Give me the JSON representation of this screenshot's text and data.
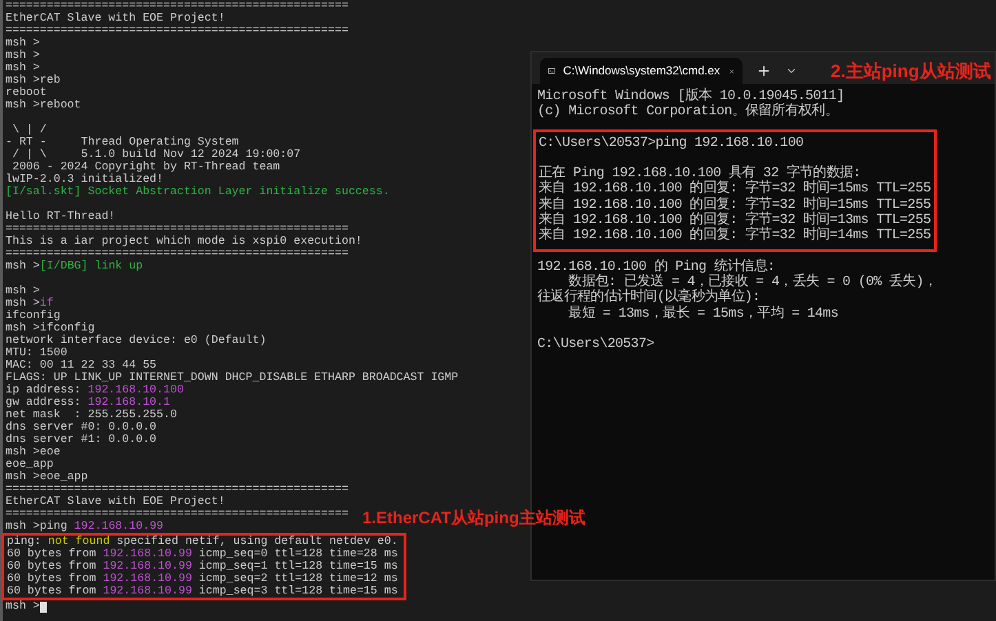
{
  "serial_terminal": {
    "cursor_visible": true,
    "blocks": [
      {
        "boxed": false,
        "lines": [
          {
            "kind": "text",
            "segments": [
              {
                "text": "==================================================",
                "color": "#cccccc"
              }
            ]
          },
          {
            "kind": "text",
            "segments": [
              {
                "text": "EtherCAT Slave with EOE Project!",
                "color": "#cccccc"
              }
            ]
          },
          {
            "kind": "text",
            "segments": [
              {
                "text": "==================================================",
                "color": "#cccccc"
              }
            ]
          },
          {
            "kind": "text",
            "segments": [
              {
                "text": "msh >",
                "color": "#cccccc"
              }
            ]
          },
          {
            "kind": "text",
            "segments": [
              {
                "text": "msh >",
                "color": "#cccccc"
              }
            ]
          },
          {
            "kind": "text",
            "segments": [
              {
                "text": "msh >",
                "color": "#cccccc"
              }
            ]
          },
          {
            "kind": "text",
            "segments": [
              {
                "text": "msh >reb",
                "color": "#cccccc"
              }
            ]
          },
          {
            "kind": "text",
            "segments": [
              {
                "text": "reboot",
                "color": "#cccccc"
              }
            ]
          },
          {
            "kind": "text",
            "segments": [
              {
                "text": "msh >reboot",
                "color": "#cccccc"
              }
            ]
          },
          {
            "kind": "blank"
          },
          {
            "kind": "text",
            "segments": [
              {
                "text": " \\ | /",
                "color": "#cccccc"
              }
            ]
          },
          {
            "kind": "text",
            "segments": [
              {
                "text": "- RT -     Thread Operating System",
                "color": "#cccccc"
              }
            ]
          },
          {
            "kind": "text",
            "segments": [
              {
                "text": " / | \\     5.1.0 build Nov 12 2024 19:00:07",
                "color": "#cccccc"
              }
            ]
          },
          {
            "kind": "text",
            "segments": [
              {
                "text": " 2006 - 2024 Copyright by RT-Thread team",
                "color": "#cccccc"
              }
            ]
          },
          {
            "kind": "text",
            "segments": [
              {
                "text": "lwIP-2.0.3 initialized!",
                "color": "#cccccc"
              }
            ]
          },
          {
            "kind": "text",
            "segments": [
              {
                "text": "[I/sal.skt] Socket Abstraction Layer initialize success.",
                "color": "#2fb344"
              }
            ]
          },
          {
            "kind": "blank"
          },
          {
            "kind": "text",
            "segments": [
              {
                "text": "Hello RT-Thread!",
                "color": "#cccccc"
              }
            ]
          },
          {
            "kind": "text",
            "segments": [
              {
                "text": "==================================================",
                "color": "#cccccc"
              }
            ]
          },
          {
            "kind": "text",
            "segments": [
              {
                "text": "This is a iar project which mode is xspi0 execution!",
                "color": "#cccccc"
              }
            ]
          },
          {
            "kind": "text",
            "segments": [
              {
                "text": "==================================================",
                "color": "#cccccc"
              }
            ]
          },
          {
            "kind": "text",
            "segments": [
              {
                "text": "msh >",
                "color": "#cccccc"
              },
              {
                "text": "[I/DBG] link up",
                "color": "#2fb344"
              }
            ]
          },
          {
            "kind": "blank"
          },
          {
            "kind": "text",
            "segments": [
              {
                "text": "msh >",
                "color": "#cccccc"
              }
            ]
          },
          {
            "kind": "text",
            "segments": [
              {
                "text": "msh >",
                "color": "#cccccc"
              },
              {
                "text": "if",
                "color": "#c24fd6"
              }
            ]
          },
          {
            "kind": "text",
            "segments": [
              {
                "text": "ifconfig",
                "color": "#cccccc"
              }
            ]
          },
          {
            "kind": "text",
            "segments": [
              {
                "text": "msh >ifconfig",
                "color": "#cccccc"
              }
            ]
          },
          {
            "kind": "text",
            "segments": [
              {
                "text": "network interface device: e0 (Default)",
                "color": "#cccccc"
              }
            ]
          },
          {
            "kind": "text",
            "segments": [
              {
                "text": "MTU: 1500",
                "color": "#cccccc"
              }
            ]
          },
          {
            "kind": "text",
            "segments": [
              {
                "text": "MAC: 00 11 22 33 44 55",
                "color": "#cccccc"
              }
            ]
          },
          {
            "kind": "text",
            "segments": [
              {
                "text": "FLAGS: UP LINK_UP INTERNET_DOWN DHCP_DISABLE ETHARP BROADCAST IGMP",
                "color": "#cccccc"
              }
            ]
          },
          {
            "kind": "text",
            "segments": [
              {
                "text": "ip address: ",
                "color": "#cccccc"
              },
              {
                "text": "192.168.10.100",
                "color": "#c24fd6"
              }
            ]
          },
          {
            "kind": "text",
            "segments": [
              {
                "text": "gw address: ",
                "color": "#cccccc"
              },
              {
                "text": "192.168.10.1",
                "color": "#c24fd6"
              }
            ]
          },
          {
            "kind": "text",
            "segments": [
              {
                "text": "net mask  : 255.255.255.0",
                "color": "#cccccc"
              }
            ]
          },
          {
            "kind": "text",
            "segments": [
              {
                "text": "dns server #0: 0.0.0.0",
                "color": "#cccccc"
              }
            ]
          },
          {
            "kind": "text",
            "segments": [
              {
                "text": "dns server #1: 0.0.0.0",
                "color": "#cccccc"
              }
            ]
          },
          {
            "kind": "text",
            "segments": [
              {
                "text": "msh >eoe",
                "color": "#cccccc"
              }
            ]
          },
          {
            "kind": "text",
            "segments": [
              {
                "text": "eoe_app",
                "color": "#cccccc"
              }
            ]
          },
          {
            "kind": "text",
            "segments": [
              {
                "text": "msh >eoe_app",
                "color": "#cccccc"
              }
            ]
          },
          {
            "kind": "text",
            "segments": [
              {
                "text": "==================================================",
                "color": "#cccccc"
              }
            ]
          },
          {
            "kind": "text",
            "segments": [
              {
                "text": "EtherCAT Slave with EOE Project!",
                "color": "#cccccc"
              }
            ]
          },
          {
            "kind": "text",
            "segments": [
              {
                "text": "==================================================",
                "color": "#cccccc"
              }
            ]
          },
          {
            "kind": "text",
            "segments": [
              {
                "text": "msh >ping ",
                "color": "#cccccc"
              },
              {
                "text": "192.168.10.99",
                "color": "#c24fd6"
              }
            ]
          }
        ]
      },
      {
        "boxed": true,
        "lines": [
          {
            "kind": "text",
            "segments": [
              {
                "text": "ping: ",
                "color": "#cccccc"
              },
              {
                "text": "not found",
                "color": "#c8c800"
              },
              {
                "text": " specified netif, using default netdev e0.",
                "color": "#cccccc"
              }
            ]
          },
          {
            "kind": "text",
            "segments": [
              {
                "text": "60 bytes from ",
                "color": "#cccccc"
              },
              {
                "text": "192.168.10.99",
                "color": "#c24fd6"
              },
              {
                "text": " icmp_seq=0 ttl=128 time=28 ms",
                "color": "#cccccc"
              }
            ]
          },
          {
            "kind": "text",
            "segments": [
              {
                "text": "60 bytes from ",
                "color": "#cccccc"
              },
              {
                "text": "192.168.10.99",
                "color": "#c24fd6"
              },
              {
                "text": " icmp_seq=1 ttl=128 time=15 ms",
                "color": "#cccccc"
              }
            ]
          },
          {
            "kind": "text",
            "segments": [
              {
                "text": "60 bytes from ",
                "color": "#cccccc"
              },
              {
                "text": "192.168.10.99",
                "color": "#c24fd6"
              },
              {
                "text": " icmp_seq=2 ttl=128 time=12 ms",
                "color": "#cccccc"
              }
            ]
          },
          {
            "kind": "text",
            "segments": [
              {
                "text": "60 bytes from ",
                "color": "#cccccc"
              },
              {
                "text": "192.168.10.99",
                "color": "#c24fd6"
              },
              {
                "text": " icmp_seq=3 ttl=128 time=15 ms",
                "color": "#cccccc"
              }
            ]
          }
        ]
      },
      {
        "boxed": false,
        "lines": [
          {
            "kind": "text",
            "segments": [
              {
                "text": "msh >",
                "color": "#cccccc"
              }
            ]
          }
        ]
      }
    ]
  },
  "annotation_1": "1.EtherCAT从站ping主站测试",
  "cmd_window": {
    "tab": {
      "title": "C:\\Windows\\system32\\cmd.ex",
      "selected": true
    },
    "annotation_2": "2.主站ping从站测试",
    "blocks": [
      {
        "boxed": false,
        "lines": [
          {
            "kind": "text",
            "text": "Microsoft Windows [版本 10.0.19045.5011]"
          },
          {
            "kind": "text",
            "text": "(c) Microsoft Corporation。保留所有权利。"
          }
        ]
      },
      {
        "boxed": true,
        "lines": [
          {
            "kind": "text",
            "text": "C:\\Users\\20537>ping 192.168.10.100"
          },
          {
            "kind": "blank"
          },
          {
            "kind": "text",
            "text": "正在 Ping 192.168.10.100 具有 32 字节的数据:"
          },
          {
            "kind": "text",
            "text": "来自 192.168.10.100 的回复: 字节=32 时间=15ms TTL=255"
          },
          {
            "kind": "text",
            "text": "来自 192.168.10.100 的回复: 字节=32 时间=15ms TTL=255"
          },
          {
            "kind": "text",
            "text": "来自 192.168.10.100 的回复: 字节=32 时间=13ms TTL=255"
          },
          {
            "kind": "text",
            "text": "来自 192.168.10.100 的回复: 字节=32 时间=14ms TTL=255"
          }
        ]
      },
      {
        "boxed": false,
        "lines": [
          {
            "kind": "text",
            "text": "192.168.10.100 的 Ping 统计信息:"
          },
          {
            "kind": "text",
            "text": "    数据包: 已发送 = 4，已接收 = 4，丢失 = 0 (0% 丢失)，"
          },
          {
            "kind": "text",
            "text": "往返行程的估计时间(以毫秒为单位):"
          },
          {
            "kind": "text",
            "text": "    最短 = 13ms，最长 = 15ms，平均 = 14ms"
          },
          {
            "kind": "blank"
          },
          {
            "kind": "text",
            "text": "C:\\Users\\20537>"
          }
        ]
      }
    ]
  }
}
